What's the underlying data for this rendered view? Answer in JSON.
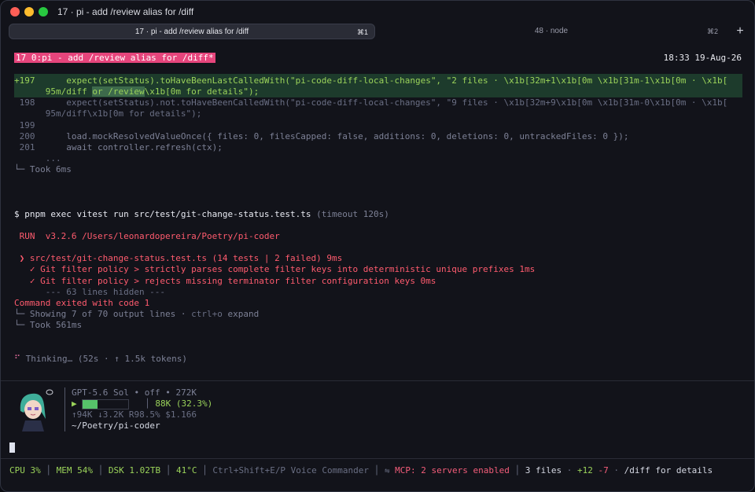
{
  "window": {
    "title": "17 · pi - add /review alias for /diff"
  },
  "tabs": [
    {
      "label": "17 · pi - add /review alias for /diff",
      "shortcut": "⌘1"
    },
    {
      "label": "48 · node",
      "shortcut": "⌘2"
    }
  ],
  "new_tab_label": "+",
  "tmux": {
    "session": "17 0:pi - add /review alias for /diff*",
    "clock": "18:33 19-Aug-26"
  },
  "diff": {
    "l197_prefix": "+197",
    "l197_a": "      expect(setStatus).toHaveBeenLastCalledWith(\"pi-code-diff-local-changes\", \"2 files · \\x1b[32m+1\\x1b[0m \\x1b[31m-1\\x1b[0m · \\x1b[",
    "l197_b": "      95m/diff ",
    "l197_hl": "or /review",
    "l197_c": "\\x1b[0m for details\");",
    "l198": " 198      expect(setStatus).not.toHaveBeenCalledWith(\"pi-code-diff-local-changes\", \"9 files · \\x1b[32m+9\\x1b[0m \\x1b[31m-0\\x1b[0m · \\x1b[",
    "l198b": "      95m/diff\\x1b[0m for details\");",
    "l199": " 199",
    "l200_num": " 200",
    "l200_code": "      load.mockResolvedValueOnce({ files: 0, filesCapped: false, additions: 0, deletions: 0, untrackedFiles: 0 });",
    "l201_num": " 201",
    "l201_code": "      await controller.refresh(ctx);",
    "ellipsis": "      ...",
    "took": "└─ Took 6ms"
  },
  "command": {
    "prompt": "$ pnpm exec vitest run src/test/git-change-status.test.ts",
    "timeout": " (timeout 120s)",
    "run_line": " RUN  v3.2.6 /Users/leonardopereira/Poetry/pi-coder",
    "file_line": " ❯ src/test/git-change-status.test.ts (14 tests | 2 failed) 9ms",
    "test1": "   ✓ Git filter policy > strictly parses complete filter keys into deterministic unique prefixes 1ms",
    "test2": "   ✓ Git filter policy > rejects missing terminator filter configuration keys 0ms",
    "hidden": "      --- 63 lines hidden ---",
    "exit": "Command exited with code 1",
    "showing": "└─ Showing 7 of 70 output lines · ",
    "expand_key": "ctrl+o",
    "expand": " expand",
    "took": "└─ Took 561ms"
  },
  "thinking": {
    "icon": "⠋",
    "text": " Thinking… (52s · ↑ 1.5k tokens)"
  },
  "agent": {
    "model": "GPT-5.6 Sol • off • 272K",
    "progress_label": "88K (32.3%)",
    "progress_fraction": 0.323,
    "tokens": "↑94K ↓3.2K R98.5% $1.166",
    "cwd": "~/Poetry/pi-coder"
  },
  "statusbar": {
    "cpu": "CPU 3%",
    "mem": "MEM 54%",
    "dsk": "DSK 1.02TB",
    "temp": "41°C",
    "voice": "Ctrl+Shift+E/P Voice Commander",
    "mcp": "MCP: 2 servers enabled",
    "files": "3 files",
    "added": "+12",
    "removed": "-7",
    "diff_hint": "/diff for details"
  },
  "colors": {
    "tmux_accent": "#e6457c",
    "diff_add_bg": "#1d3b2c",
    "error": "#ff5b6e",
    "ok": "#56c26a"
  }
}
